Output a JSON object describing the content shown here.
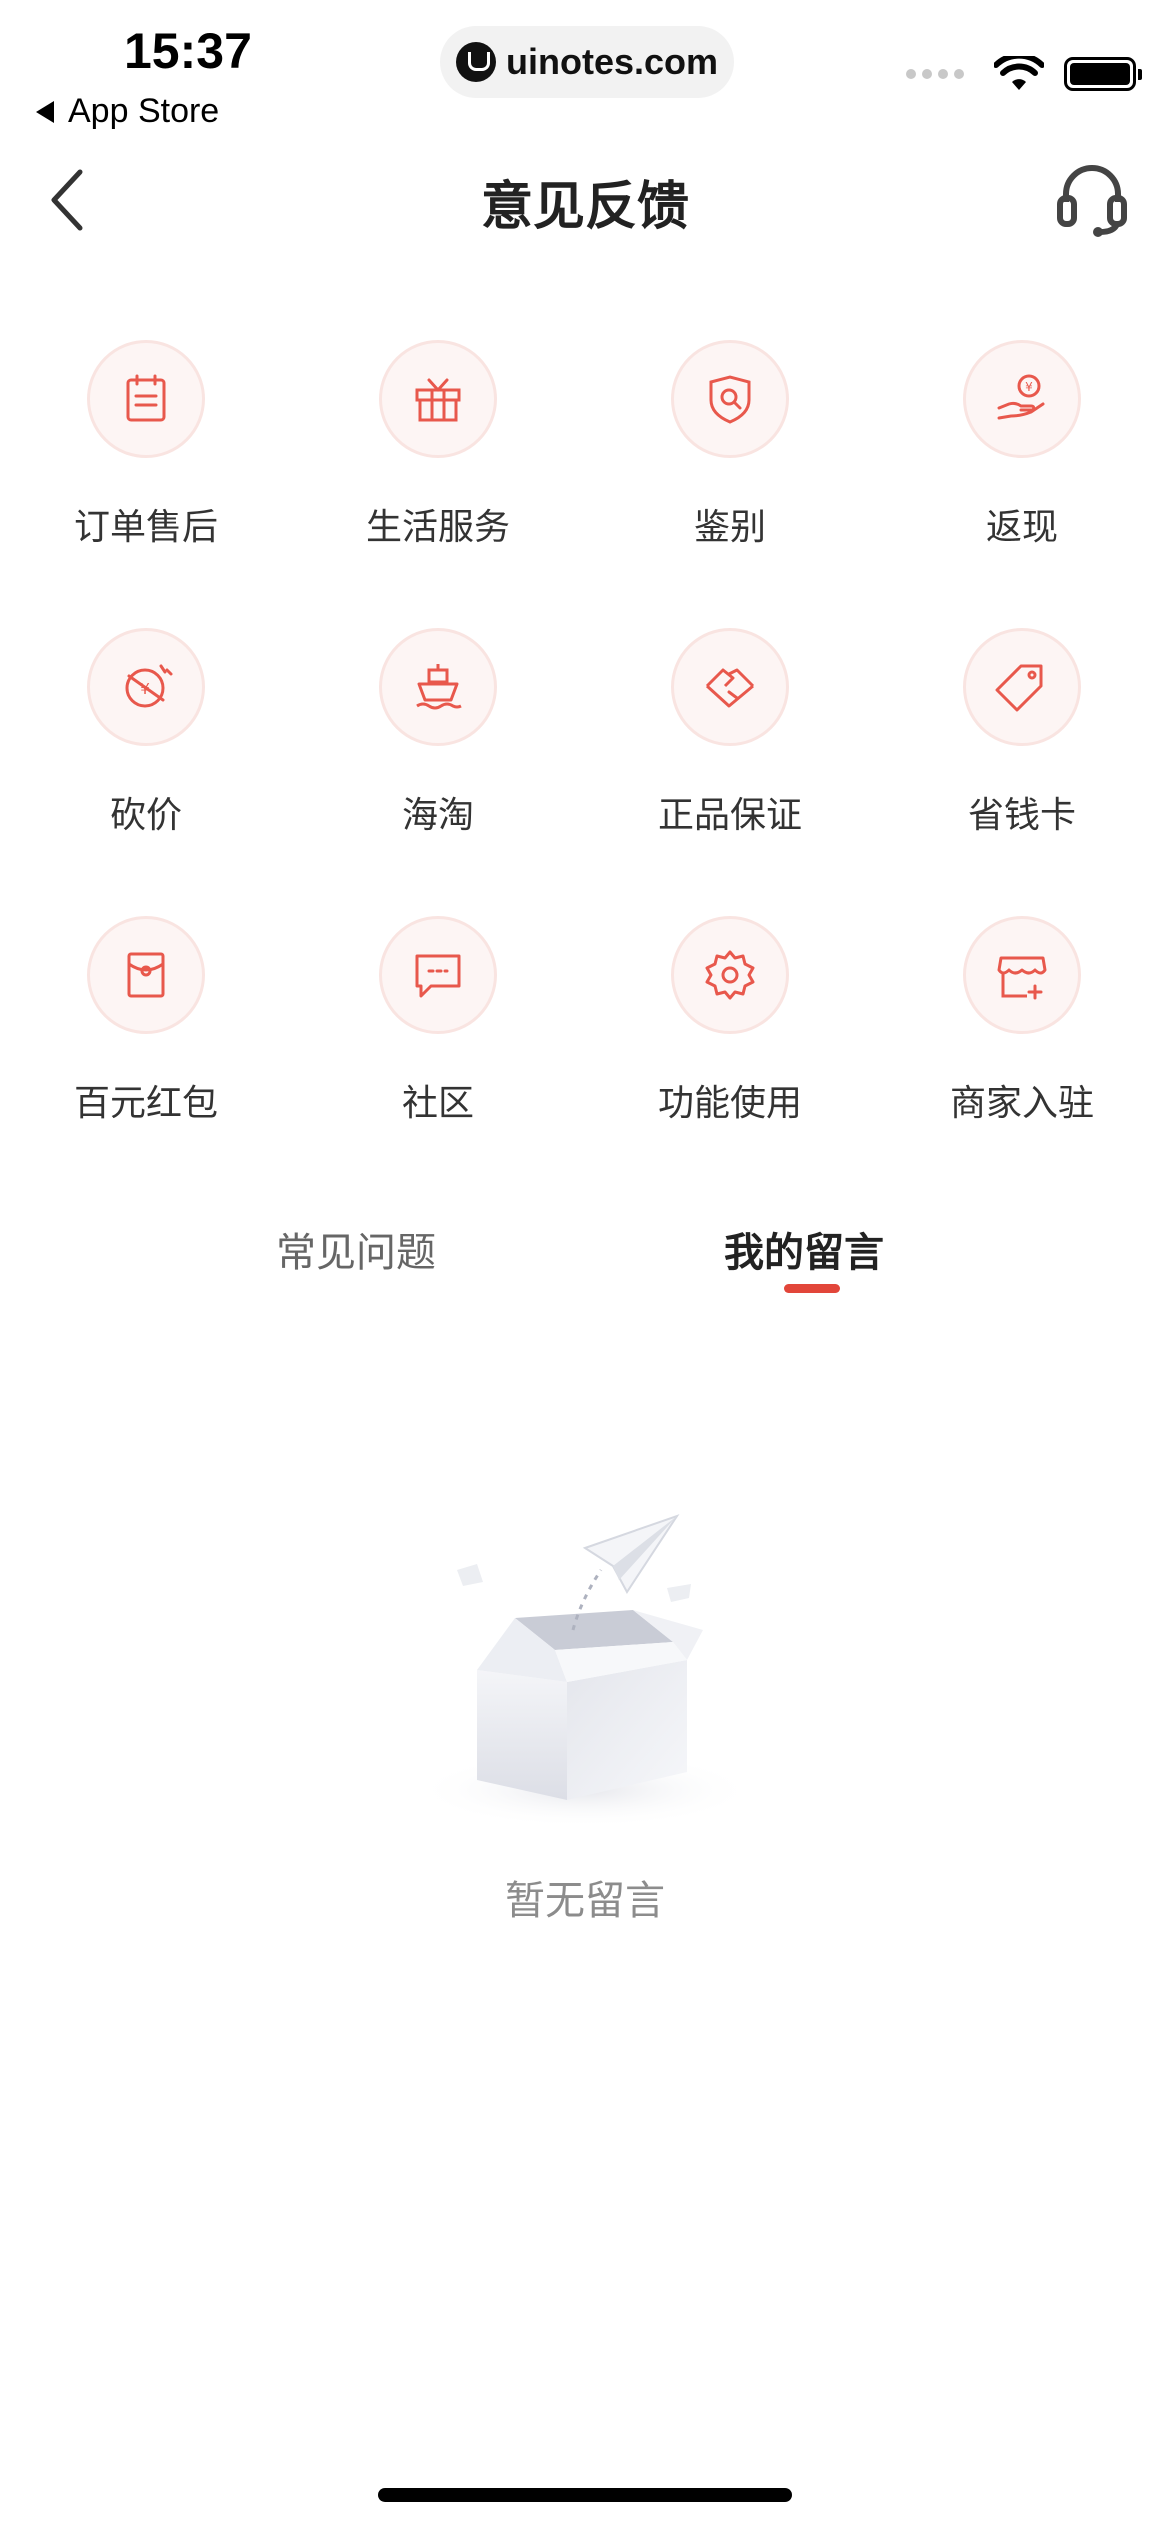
{
  "status_bar": {
    "time": "15:37",
    "back_app": "App Store",
    "url": "uinotes.com"
  },
  "header": {
    "title": "意见反馈"
  },
  "categories": [
    {
      "label": "订单售后",
      "icon": "order-icon"
    },
    {
      "label": "生活服务",
      "icon": "gift-icon"
    },
    {
      "label": "鉴别",
      "icon": "authenticate-icon"
    },
    {
      "label": "返现",
      "icon": "cashback-icon"
    },
    {
      "label": "砍价",
      "icon": "bargain-icon"
    },
    {
      "label": "海淘",
      "icon": "ship-icon"
    },
    {
      "label": "正品保证",
      "icon": "handshake-icon"
    },
    {
      "label": "省钱卡",
      "icon": "tag-icon"
    },
    {
      "label": "百元红包",
      "icon": "red-envelope-icon"
    },
    {
      "label": "社区",
      "icon": "chat-icon"
    },
    {
      "label": "功能使用",
      "icon": "gear-icon"
    },
    {
      "label": "商家入驻",
      "icon": "store-icon"
    }
  ],
  "tabs": [
    {
      "label": "常见问题",
      "active": false
    },
    {
      "label": "我的留言",
      "active": true
    }
  ],
  "empty_state": {
    "text": "暂无留言"
  },
  "colors": {
    "accent": "#e2463a",
    "icon_stroke": "#e8584c",
    "icon_bg": "#fdf5f4"
  }
}
